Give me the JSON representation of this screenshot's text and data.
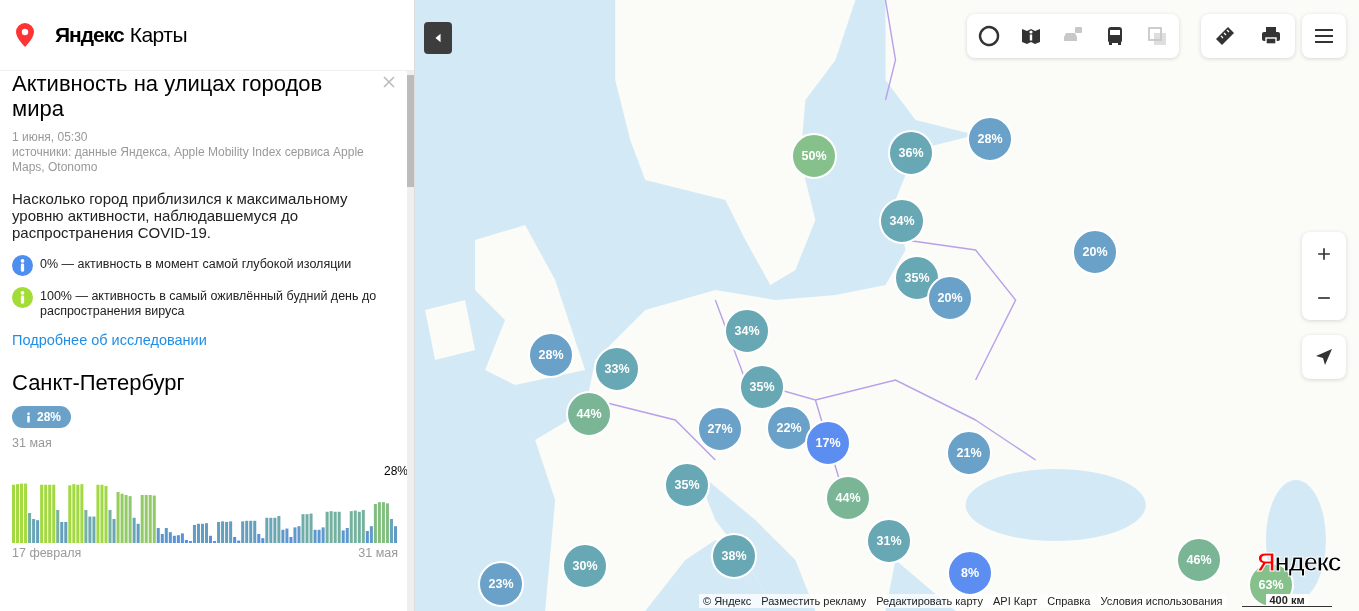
{
  "header": {
    "brand": "Яндекс",
    "product": "Карты"
  },
  "panel": {
    "title": "Активность на улицах городов мира",
    "date": "1 июня, 05:30",
    "sources": "источники: данные Яндекса, Apple Mobility Index сервиса Apple Maps, Otonomo",
    "description": "Насколько город приблизился к максимальному уровню активности, наблюдавшемуся до распространения COVID-19.",
    "legend": [
      {
        "text": "0% — активность в момент самой глубокой изоляции",
        "color": "#4d8ef0"
      },
      {
        "text": "100% — активность в самый оживлённый будний день до распространения вируса",
        "color": "#a2dc34"
      }
    ],
    "link": "Подробнее об исследовании"
  },
  "city": {
    "name": "Санкт-Петербург",
    "badge": "28%",
    "color": "#6aa1c8",
    "date": "31 мая",
    "current_label": "28%",
    "start_label": "17 февраля",
    "end_label": "31 мая"
  },
  "map": {
    "toolbar": [
      {
        "disabled": false
      },
      {
        "disabled": false
      },
      {
        "disabled": true
      },
      {
        "disabled": false
      },
      {
        "disabled": true
      }
    ],
    "markers": [
      {
        "label": "50%",
        "color": "#86c08a"
      },
      {
        "label": "36%",
        "color": "#68a8b4"
      },
      {
        "label": "28%",
        "color": "#6aa1c8"
      },
      {
        "label": "34%",
        "color": "#68a8b4"
      },
      {
        "label": "20%",
        "color": "#6aa1c8"
      },
      {
        "label": "35%",
        "color": "#68a8b4"
      },
      {
        "label": "20%",
        "color": "#6aa1c8"
      },
      {
        "label": "34%",
        "color": "#68a8b4"
      },
      {
        "label": "28%",
        "color": "#6aa1c8"
      },
      {
        "label": "33%",
        "color": "#68a8b4"
      },
      {
        "label": "35%",
        "color": "#68a8b4"
      },
      {
        "label": "44%",
        "color": "#7ab696"
      },
      {
        "label": "27%",
        "color": "#6aa1c8"
      },
      {
        "label": "22%",
        "color": "#6aa1c8"
      },
      {
        "label": "17%",
        "color": "#5b8ef0"
      },
      {
        "label": "21%",
        "color": "#6aa1c8"
      },
      {
        "label": "35%",
        "color": "#68a8b4"
      },
      {
        "label": "44%",
        "color": "#7ab696"
      },
      {
        "label": "31%",
        "color": "#68a8b4"
      },
      {
        "label": "38%",
        "color": "#68a8b4"
      },
      {
        "label": "30%",
        "color": "#68a8b4"
      },
      {
        "label": "23%",
        "color": "#6aa1c8"
      },
      {
        "label": "8%",
        "color": "#5b8ef0"
      },
      {
        "label": "46%",
        "color": "#7ab696"
      },
      {
        "label": "63%",
        "color": "#86c08a"
      }
    ],
    "attribution": [
      "© Яндекс",
      "Разместить рекламу",
      "Редактировать карту",
      "API Карт",
      "Справка",
      "Условия использования"
    ],
    "scale": "400 км",
    "logo": "Яндекс"
  }
}
